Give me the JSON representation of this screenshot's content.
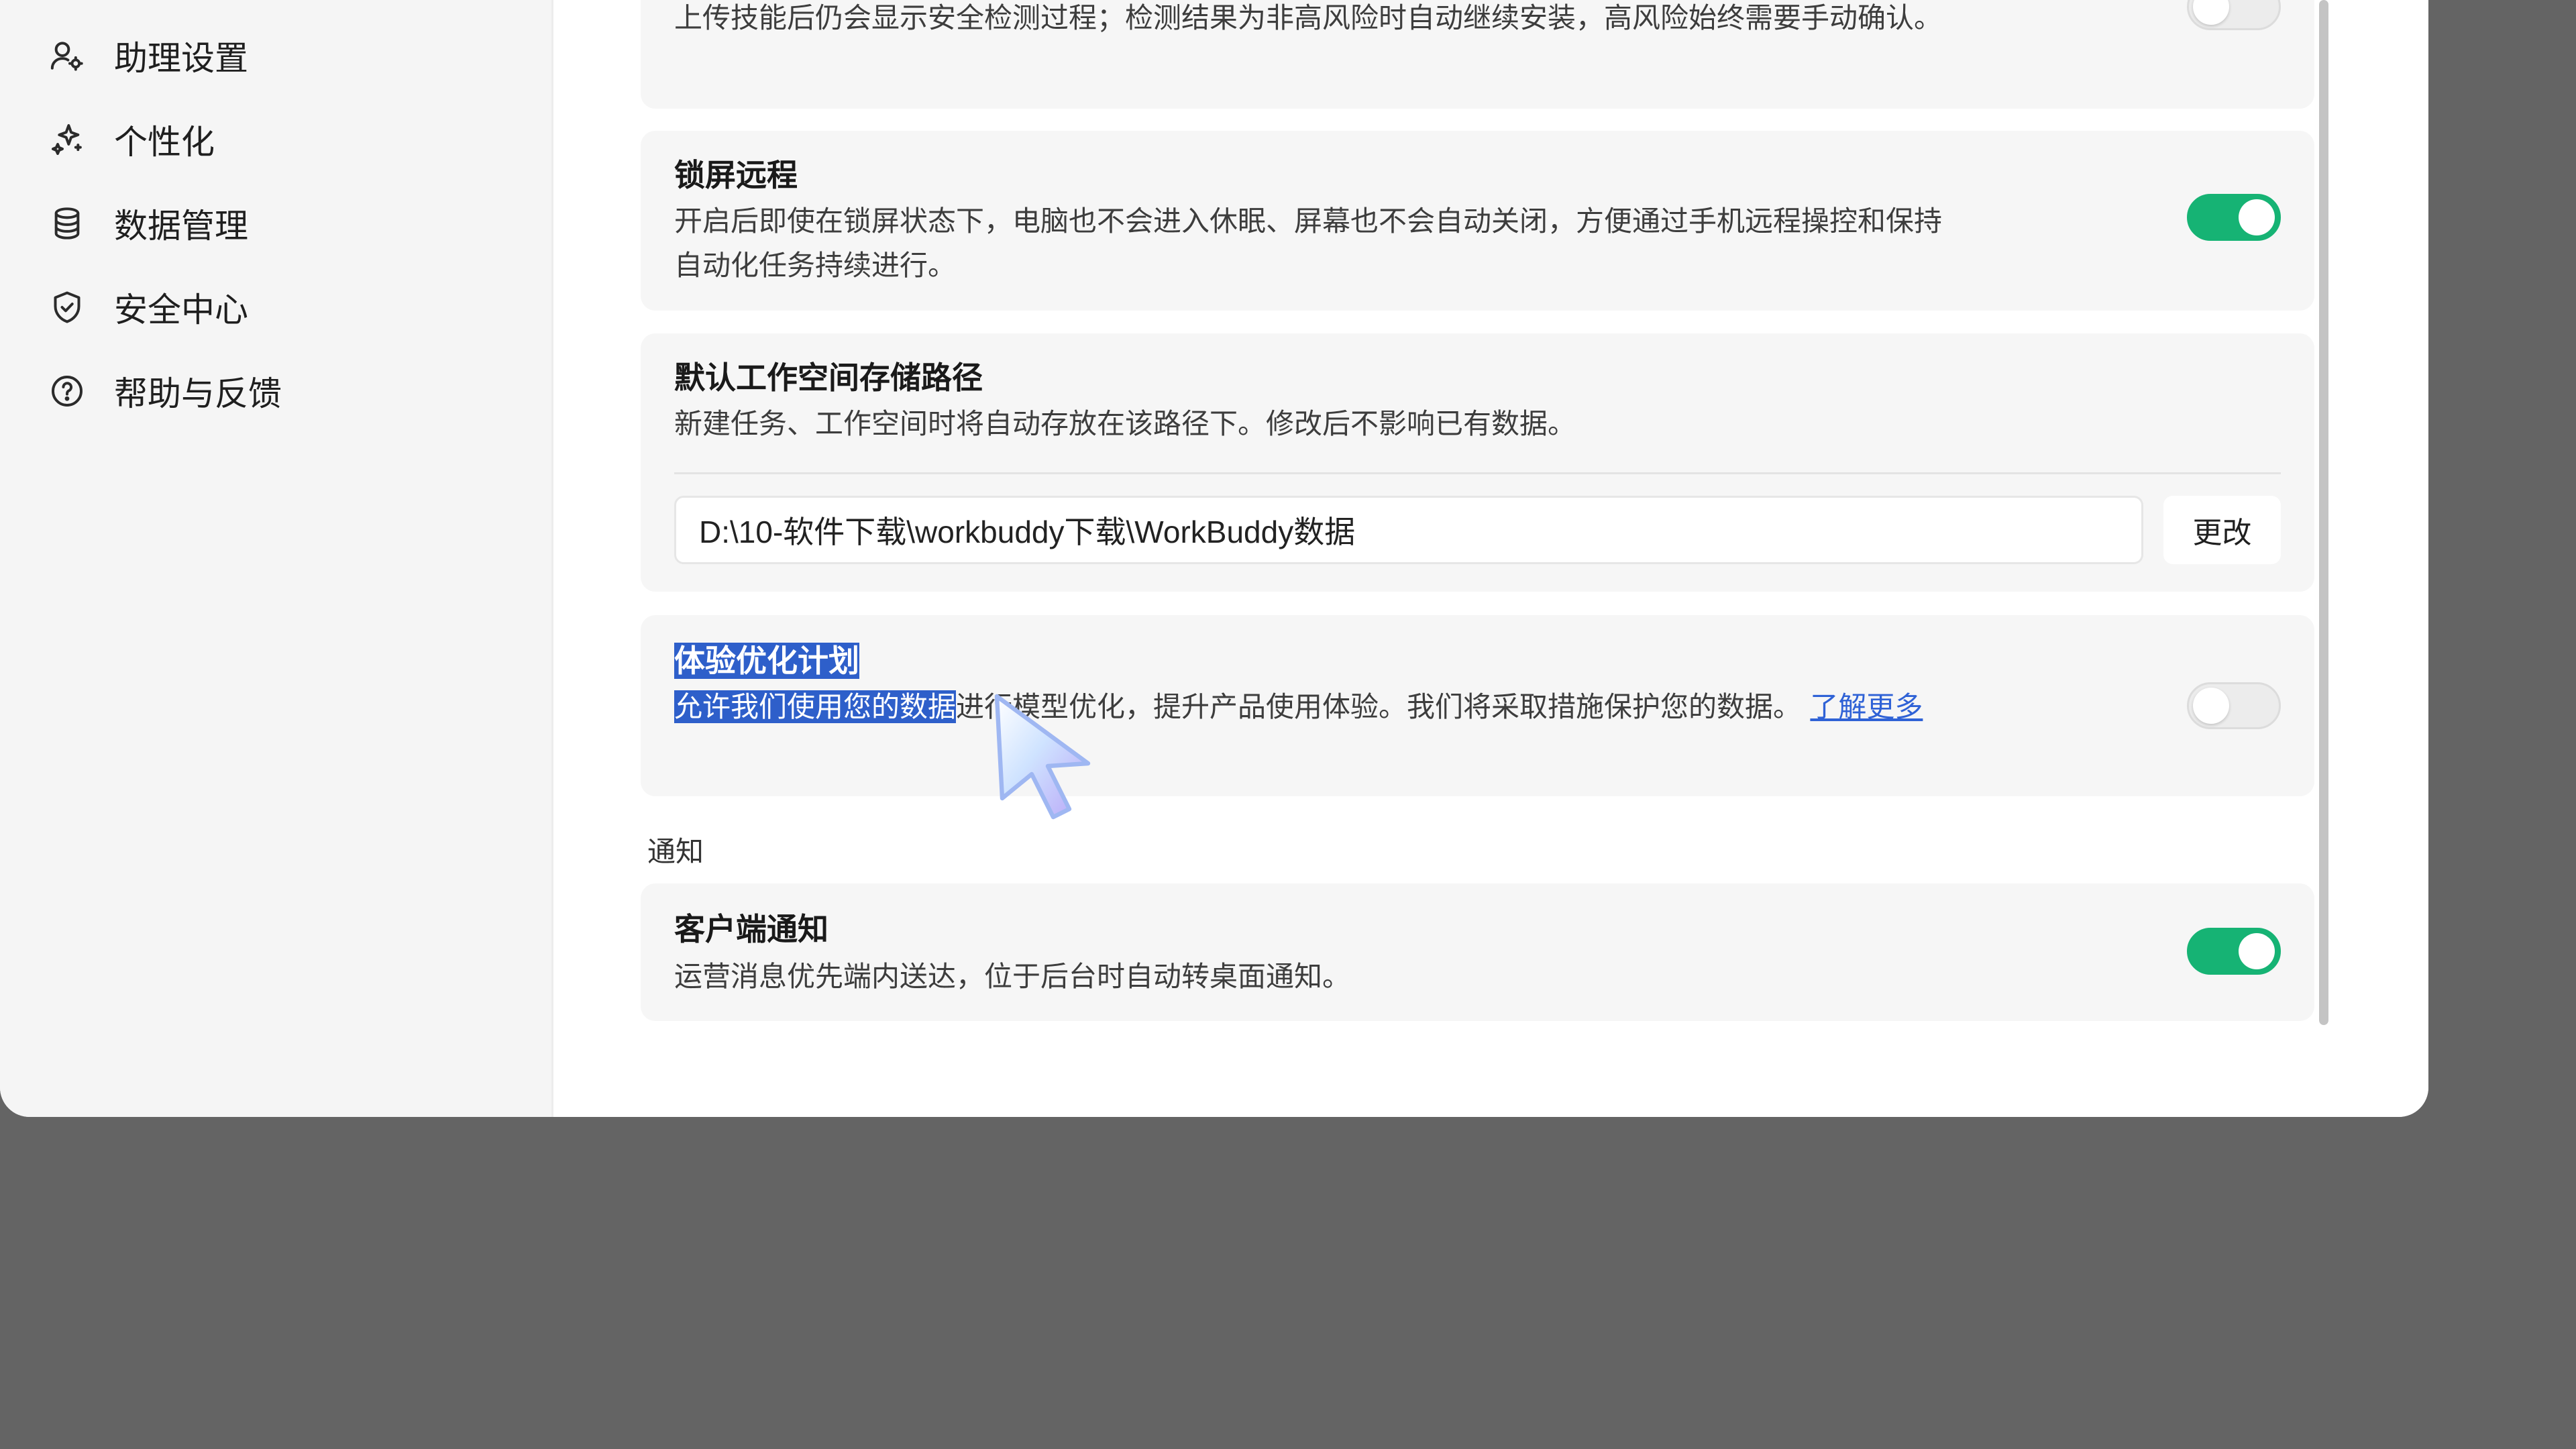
{
  "sidebar": {
    "items": [
      {
        "label": "助理设置",
        "icon": "assistant-user-icon"
      },
      {
        "label": "个性化",
        "icon": "sparkle-icon"
      },
      {
        "label": "数据管理",
        "icon": "database-icon"
      },
      {
        "label": "安全中心",
        "icon": "shield-icon"
      },
      {
        "label": "帮助与反馈",
        "icon": "help-circle-icon"
      }
    ]
  },
  "settings": {
    "skill_check": {
      "desc": "上传技能后仍会显示安全检测过程；检测结果为非高风险时自动继续安装，高风险始终需要手动确认。",
      "enabled": false
    },
    "lock_remote": {
      "title": "锁屏远程",
      "desc": "开启后即使在锁屏状态下，电脑也不会进入休眠、屏幕也不会自动关闭，方便通过手机远程操控和保持自动化任务持续进行。",
      "enabled": true
    },
    "workspace_path": {
      "title": "默认工作空间存储路径",
      "desc": "新建任务、工作空间时将自动存放在该路径下。修改后不影响已有数据。",
      "value": "D:\\10-软件下载\\workbuddy下载\\WorkBuddy数据",
      "change_label": "更改"
    },
    "experience_plan": {
      "title": "体验优化计划",
      "desc_selected": "允许我们使用您的数据",
      "desc_rest": "进行模型优化，提升产品使用体验。我们将采取措施保护您的数据。",
      "link": "了解更多",
      "enabled": false
    }
  },
  "notifications": {
    "section_label": "通知",
    "client": {
      "title": "客户端通知",
      "desc": "运营消息优先端内送达，位于后台时自动转桌面通知。",
      "enabled": true
    }
  },
  "colors": {
    "toggle_on": "#16b374",
    "selection": "#2e5fca",
    "link": "#2f62d6",
    "backdrop": "#646464"
  }
}
